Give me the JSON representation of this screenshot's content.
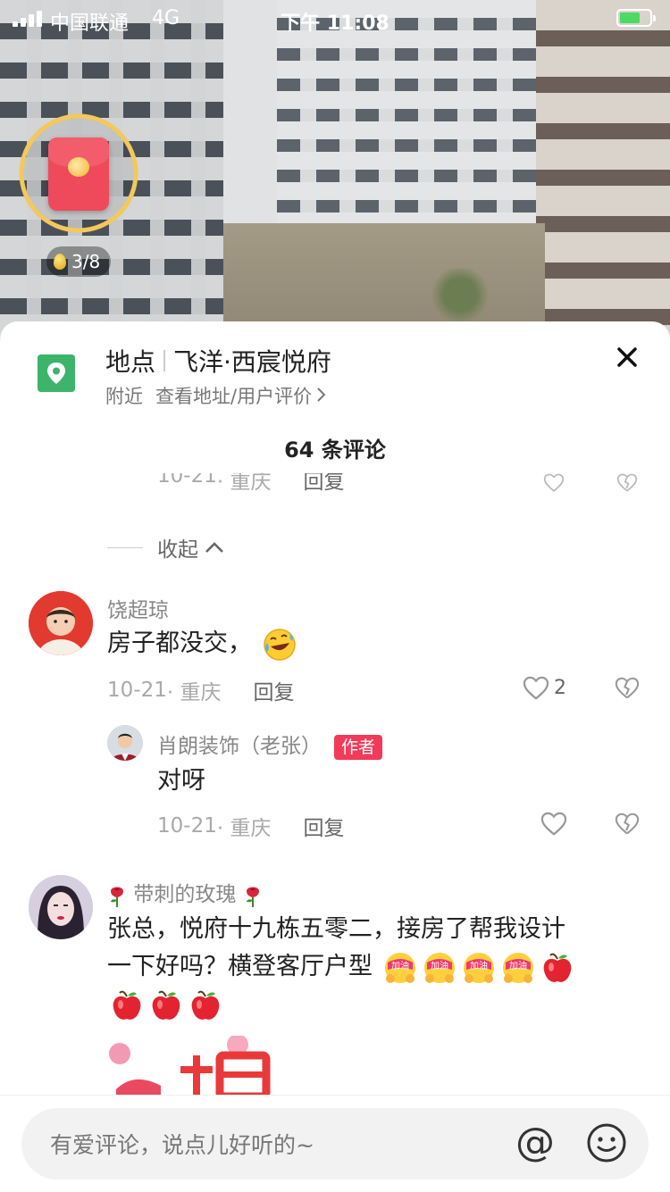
{
  "status_bar": {
    "carrier": "中国联通",
    "network": "4G",
    "time": "下午 11:08",
    "battery_level": 0.7,
    "accent_charging": "#4cd964"
  },
  "reward": {
    "progress": "3/8",
    "envelope_color": "#ef4a5b"
  },
  "location": {
    "label": "地点",
    "name": "飞洋·西宸悦府",
    "nearby": "附近",
    "detail_link": "查看地址/用户评价",
    "icon": "location-pin-icon",
    "icon_color": "#3cb46b"
  },
  "comments_header": {
    "count_label": "64 条评论"
  },
  "partial_row": {
    "date": "10-21",
    "place": "· 重庆",
    "reply": "回复"
  },
  "collapse": {
    "label": "收起"
  },
  "comments": [
    {
      "user": "饶超琼",
      "text": "房子都没交，",
      "emoji": "laughing-crying-emoji",
      "date": "10-21",
      "place": "· 重庆",
      "reply": "回复",
      "likes": "2",
      "replies": [
        {
          "user": "肖朗装饰（老张）",
          "badge": "作者",
          "text": "对呀",
          "date": "10-21",
          "place": "· 重庆",
          "reply": "回复"
        }
      ]
    },
    {
      "user": "带刺的玫瑰",
      "text_line1": "张总，悦府十九栋五零二，接房了帮我设计",
      "text_line2": "一下好吗？横登客厅户型",
      "emoji_badge_text": "加油",
      "emojis": [
        "jiayou-emoji",
        "jiayou-emoji",
        "jiayou-emoji",
        "jiayou-emoji",
        "apple-emoji",
        "apple-emoji",
        "apple-emoji",
        "apple-emoji"
      ]
    }
  ],
  "input": {
    "placeholder": "有爱评论，说点儿好听的~",
    "at_symbol": "@"
  },
  "colors": {
    "author_badge": "#f23b5a",
    "text_primary": "#222222",
    "text_secondary": "#a9a9a9"
  }
}
